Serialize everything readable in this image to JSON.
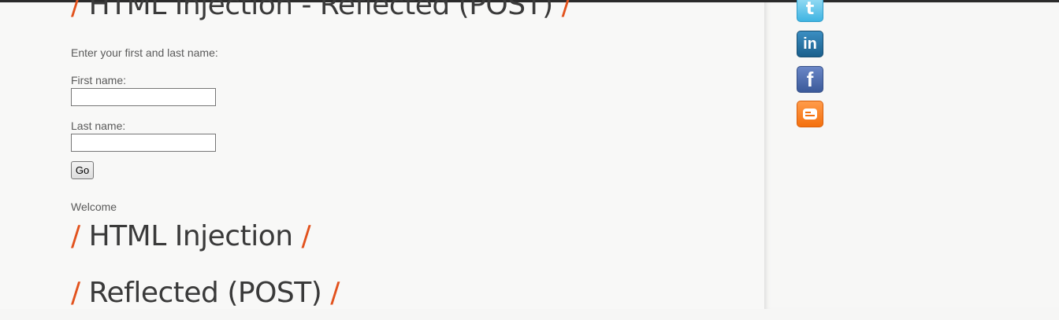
{
  "main": {
    "top_heading": {
      "slash": "/",
      "text": "HTML Injection - Reflected (POST)"
    },
    "intro": "Enter your first and last name:",
    "form": {
      "first_name_label": "First name:",
      "first_name_value": "",
      "last_name_label": "Last name:",
      "last_name_value": "",
      "submit_label": "Go"
    },
    "welcome": "Welcome",
    "headings": [
      {
        "slash": "/",
        "text": "HTML Injection"
      },
      {
        "slash": "/",
        "text": "Reflected (POST)"
      }
    ]
  },
  "sidebar": {
    "social_links": [
      {
        "name": "twitter-icon",
        "glyph": "t"
      },
      {
        "name": "linkedin-icon",
        "glyph": "in"
      },
      {
        "name": "facebook-icon",
        "glyph": "f"
      },
      {
        "name": "blogger-icon",
        "glyph": ""
      }
    ]
  },
  "colors": {
    "accent_slash": "#e2521d",
    "heading_text": "#3a3a3a",
    "body_text": "#5a5a5a"
  }
}
